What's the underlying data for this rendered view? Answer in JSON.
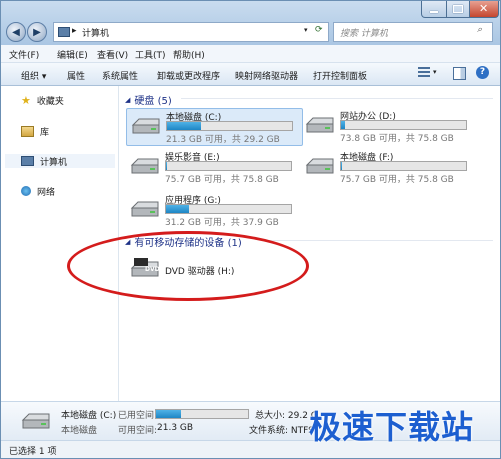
{
  "window": {
    "address": "计算机",
    "search_placeholder": "搜索 计算机"
  },
  "menu": [
    "文件(F)",
    "编辑(E)",
    "查看(V)",
    "工具(T)",
    "帮助(H)"
  ],
  "toolbar": [
    "组织 ▾",
    "属性",
    "系统属性",
    "卸载或更改程序",
    "映射网络驱动器",
    "打开控制面板"
  ],
  "sidebar": [
    {
      "label": "收藏夹",
      "icon": "star-icon"
    },
    {
      "label": "库",
      "icon": "library-icon"
    },
    {
      "label": "计算机",
      "icon": "computer-icon"
    },
    {
      "label": "网络",
      "icon": "network-icon"
    }
  ],
  "groups": {
    "hdd": "硬盘 (5)",
    "removable": "有可移动存储的设备 (1)"
  },
  "drives": [
    {
      "name": "本地磁盘 (C:)",
      "free_text": "21.3 GB 可用，共 29.2 GB",
      "used_fraction": 0.27
    },
    {
      "name": "网站办公 (D:)",
      "free_text": "73.8 GB 可用，共 75.8 GB",
      "used_fraction": 0.03
    },
    {
      "name": "娱乐影音 (E:)",
      "free_text": "75.7 GB 可用，共 75.8 GB",
      "used_fraction": 0.005
    },
    {
      "name": "本地磁盘 (F:)",
      "free_text": "75.7 GB 可用，共 75.8 GB",
      "used_fraction": 0.005
    },
    {
      "name": "应用程序 (G:)",
      "free_text": "31.2 GB 可用，共 37.9 GB",
      "used_fraction": 0.18
    }
  ],
  "dvd": {
    "name": "DVD 驱动器 (H:)",
    "badge": "DVD"
  },
  "status": {
    "drive_name": "本地磁盘 (C:)",
    "drive_type": "本地磁盘",
    "used_label": "已用空间:",
    "free_label": "可用空间:",
    "free_value": "21.3 GB",
    "total_label": "总大小: 29.2 G",
    "fs_label": "文件系统: NTFS",
    "used_fraction": 0.27
  },
  "footer": {
    "selected": "已选择 1 项"
  },
  "watermark": "极速下载站",
  "colors": {
    "accent": "#1d5fd0",
    "bar_fill": "#26a0da",
    "annotation": "#d41c1c"
  }
}
